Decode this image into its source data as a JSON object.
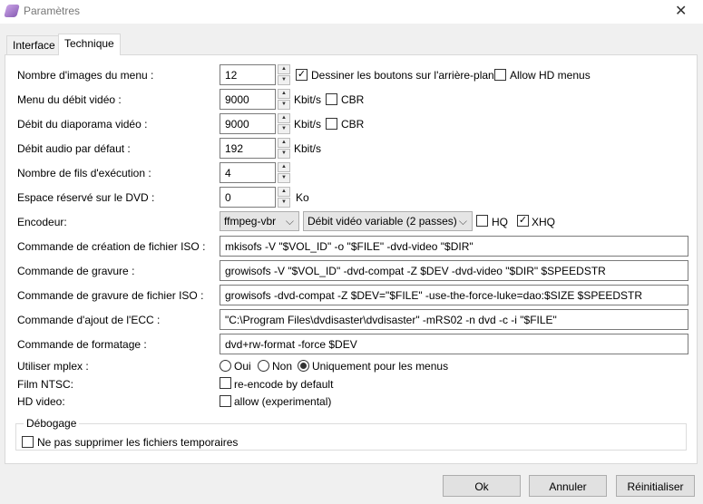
{
  "window": {
    "title": "Paramètres",
    "close": "✕"
  },
  "tabs": [
    "Interface",
    "Technique"
  ],
  "rows": {
    "menu_images": {
      "label": "Nombre d'images du menu :",
      "value": "12",
      "check_label": "Dessiner les boutons sur l'arrière-plan",
      "checked": true,
      "hd_label": "Allow HD menus",
      "hd_checked": false
    },
    "menu_bitrate": {
      "label": "Menu du débit vidéo :",
      "value": "9000",
      "unit": "Kbit/s",
      "cbr": "CBR"
    },
    "slideshow_bitrate": {
      "label": "Débit du diaporama vidéo :",
      "value": "9000",
      "unit": "Kbit/s",
      "cbr": "CBR"
    },
    "audio_bitrate": {
      "label": "Débit audio par défaut :",
      "value": "192",
      "unit": "Kbit/s"
    },
    "threads": {
      "label": "Nombre de fils d'exécution :",
      "value": "4"
    },
    "reserved": {
      "label": "Espace réservé sur le DVD :",
      "value": "0",
      "unit": "Ko"
    },
    "encoder": {
      "label": "Encodeur:",
      "encoder": "ffmpeg-vbr",
      "mode": "Débit vidéo variable (2 passes)",
      "hq": "HQ",
      "xhq": "XHQ"
    }
  },
  "commands": [
    {
      "label": "Commande de création de fichier ISO :",
      "value": "mkisofs -V \"$VOL_ID\" -o \"$FILE\" -dvd-video \"$DIR\""
    },
    {
      "label": "Commande de gravure :",
      "value": "growisofs -V \"$VOL_ID\" -dvd-compat -Z $DEV -dvd-video \"$DIR\" $SPEEDSTR"
    },
    {
      "label": "Commande de gravure de fichier ISO :",
      "value": "growisofs -dvd-compat -Z $DEV=\"$FILE\" -use-the-force-luke=dao:$SIZE $SPEEDSTR"
    },
    {
      "label": "Commande d'ajout de l'ECC :",
      "value": "\"C:\\Program Files\\dvdisaster\\dvdisaster\" -mRS02 -n dvd -c -i \"$FILE\""
    },
    {
      "label": "Commande de formatage :",
      "value": "dvd+rw-format -force $DEV"
    }
  ],
  "mplex": {
    "label": "Utiliser mplex :",
    "options": [
      "Oui",
      "Non",
      "Uniquement pour les menus"
    ],
    "selected": 2
  },
  "ntsc": {
    "label": "Film NTSC:",
    "check": "re-encode by default"
  },
  "hd": {
    "label": "HD video:",
    "check": "allow (experimental)"
  },
  "debug": {
    "title": "Débogage",
    "check": "Ne pas supprimer les fichiers temporaires"
  },
  "buttons": {
    "ok": "Ok",
    "cancel": "Annuler",
    "reset": "Réinitialiser"
  }
}
